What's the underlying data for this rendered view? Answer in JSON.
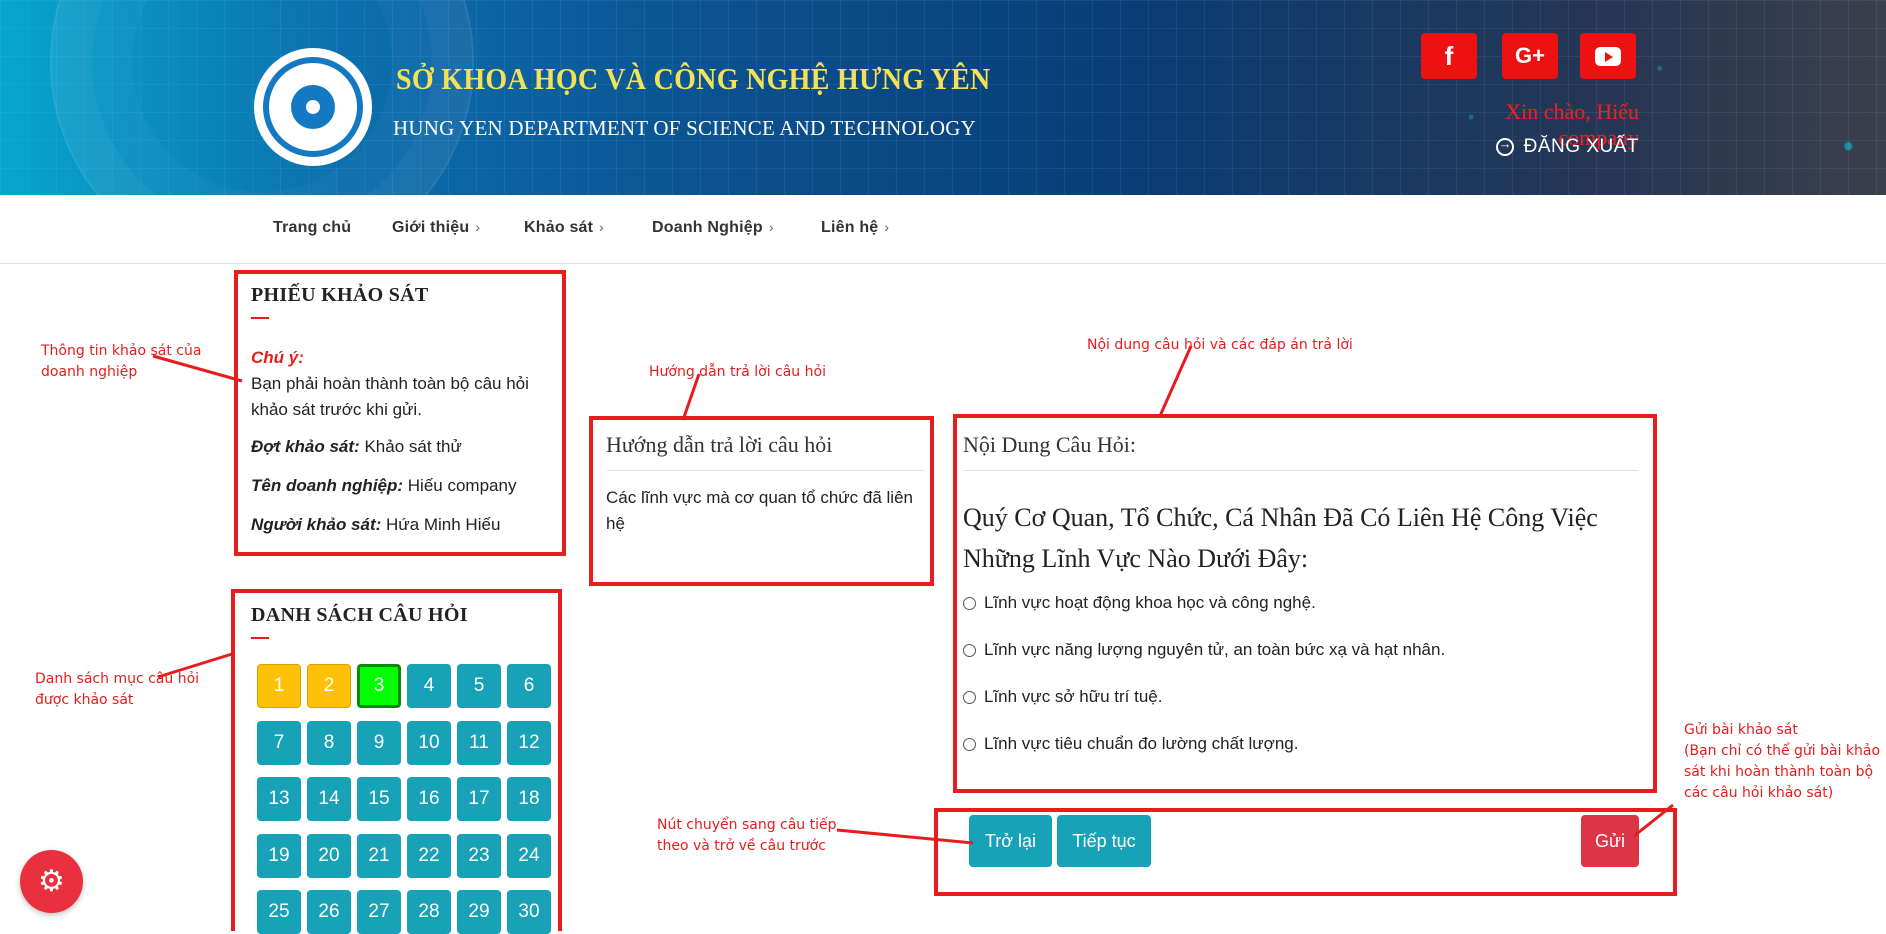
{
  "header": {
    "org_title": "SỞ KHOA HỌC VÀ CÔNG NGHỆ HƯNG YÊN",
    "org_subtitle": "HUNG YEN DEPARTMENT OF SCIENCE AND TECHNOLOGY",
    "social": [
      {
        "name": "facebook-icon",
        "glyph": "f"
      },
      {
        "name": "google-plus-icon",
        "glyph": "G+"
      },
      {
        "name": "youtube-icon",
        "glyph": ""
      }
    ],
    "greeting": "Xin chào, Hiếu company",
    "logout_label": "ĐĂNG XUẤT"
  },
  "nav": {
    "items": [
      {
        "label": "Trang chủ",
        "has_children": false
      },
      {
        "label": "Giới thiệu",
        "has_children": true
      },
      {
        "label": "Khảo sát",
        "has_children": true
      },
      {
        "label": "Doanh Nghiệp",
        "has_children": true
      },
      {
        "label": "Liên hệ",
        "has_children": true
      }
    ],
    "chevron": "›"
  },
  "survey_info": {
    "title": "PHIẾU KHẢO SÁT",
    "note_label": "Chú ý:",
    "note_text": "Bạn phải hoàn thành toàn bộ câu hỏi khảo sát trước khi gửi.",
    "round_label": "Đợt khảo sát:",
    "round_value": "Khảo sát thử",
    "company_label": "Tên doanh nghiệp:",
    "company_value": "Hiếu company",
    "surveyor_label": "Người khảo sát:",
    "surveyor_value": "Hứa Minh Hiếu"
  },
  "question_list": {
    "title": "DANH SÁCH CÂU HỎI",
    "numbers": [
      "1",
      "2",
      "3",
      "4",
      "5",
      "6",
      "7",
      "8",
      "9",
      "10",
      "11",
      "12",
      "13",
      "14",
      "15",
      "16",
      "17",
      "18",
      "19",
      "20",
      "21",
      "22",
      "23",
      "24",
      "25",
      "26",
      "27",
      "28",
      "29",
      "30"
    ],
    "done": [
      "1",
      "2"
    ],
    "current": "3"
  },
  "guide": {
    "title": "Hướng dẫn trả lời câu hỏi",
    "text": "Các lĩnh vực mà cơ quan tổ chức đã liên hệ"
  },
  "content": {
    "title": "Nội Dung Câu Hỏi:",
    "question": "Quý Cơ Quan, Tổ Chức, Cá Nhân Đã Có Liên Hệ Công Việc Những Lĩnh Vực Nào Dưới Đây:",
    "options": [
      "Lĩnh vực hoạt động khoa học và công nghệ.",
      "Lĩnh vực năng lượng nguyên tử, an toàn bức xạ và hạt nhân.",
      "Lĩnh vực sở hữu trí tuệ.",
      "Lĩnh vực tiêu chuẩn đo lường chất lượng."
    ]
  },
  "actions": {
    "back_label": "Trở lại",
    "next_label": "Tiếp tục",
    "submit_label": "Gửi"
  },
  "annotations": {
    "survey_info": "Thông tin khảo sát của doanh nghiệp",
    "guide": "Hướng dẫn trả lời câu hỏi",
    "content": "Nội dung câu hỏi và các đáp án trả lời",
    "question_list": "Danh sách mục câu hỏi được khảo sát",
    "navigation": "Nút chuyển sang câu tiếp theo và trở về câu trước",
    "submit_title": "Gửi bài khảo sát",
    "submit_note": "(Bạn chỉ có thể gửi bài khảo sát khi hoàn thành toàn bộ các câu hỏi khảo sát)"
  },
  "colors": {
    "annotation_red": "#e81c1c",
    "question_button": "#17a2b8",
    "question_done": "#ffc107",
    "question_current": "#00ff00",
    "submit_button": "#dc3545"
  }
}
